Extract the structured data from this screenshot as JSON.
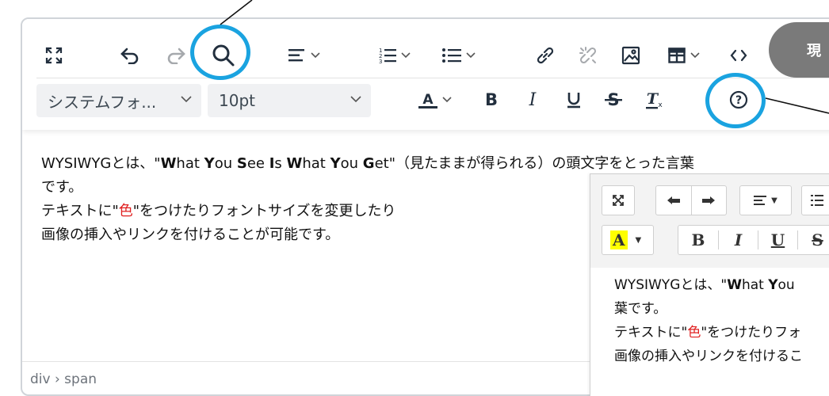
{
  "toolbar": {
    "font_family_value": "システムフォ...",
    "font_size_value": "10pt",
    "icons": [
      "fullscreen-icon",
      "undo-icon",
      "redo-icon",
      "search-icon",
      "align-icon",
      "numbered-list-icon",
      "bullet-list-icon",
      "link-icon",
      "unlink-icon",
      "image-icon",
      "table-icon",
      "code-icon",
      "text-color-icon",
      "bold-icon",
      "italic-icon",
      "underline-icon",
      "strikethrough-icon",
      "clear-format-icon",
      "help-icon"
    ]
  },
  "content": {
    "line1_prefix": "WYSIWYGとは、\"",
    "line1_w": "W",
    "line1_hat": "hat ",
    "line1_y": "Y",
    "line1_ou": "ou ",
    "line1_s": "S",
    "line1_ee": "ee ",
    "line1_i": "I",
    "line1_s2": "s ",
    "line1_w2": "W",
    "line1_hat2": "hat ",
    "line1_y2": "Y",
    "line1_ou2": "ou ",
    "line1_g": "G",
    "line1_suffix": "et\"（見たままが得られる）の頭文字をとった言葉",
    "line2": "です。",
    "line3_prefix": "テキストに\"",
    "line3_red": "色",
    "line3_suffix": "\"をつけたりフォントサイズを変更したり",
    "line4": "画像の挿入やリンクを付けることが可能です。"
  },
  "statusbar": {
    "path": "div › span"
  },
  "callout": {
    "label": "現"
  },
  "highlight_color": "#1aa3e0",
  "overlay": {
    "bold_label": "B",
    "italic_label": "I",
    "underline_label": "U",
    "strike_label": "S",
    "color_label": "A",
    "line1_prefix": "WYSIWYGとは、\"",
    "line1_w": "W",
    "line1_rest": "hat ",
    "line1_y": "Y",
    "line1_ou": "ou",
    "line2": "葉です。",
    "line3_prefix": "テキストに\"",
    "line3_red": "色",
    "line3_suffix": "\"をつけたりフォ",
    "line4": "画像の挿入やリンクを付けるこ"
  }
}
